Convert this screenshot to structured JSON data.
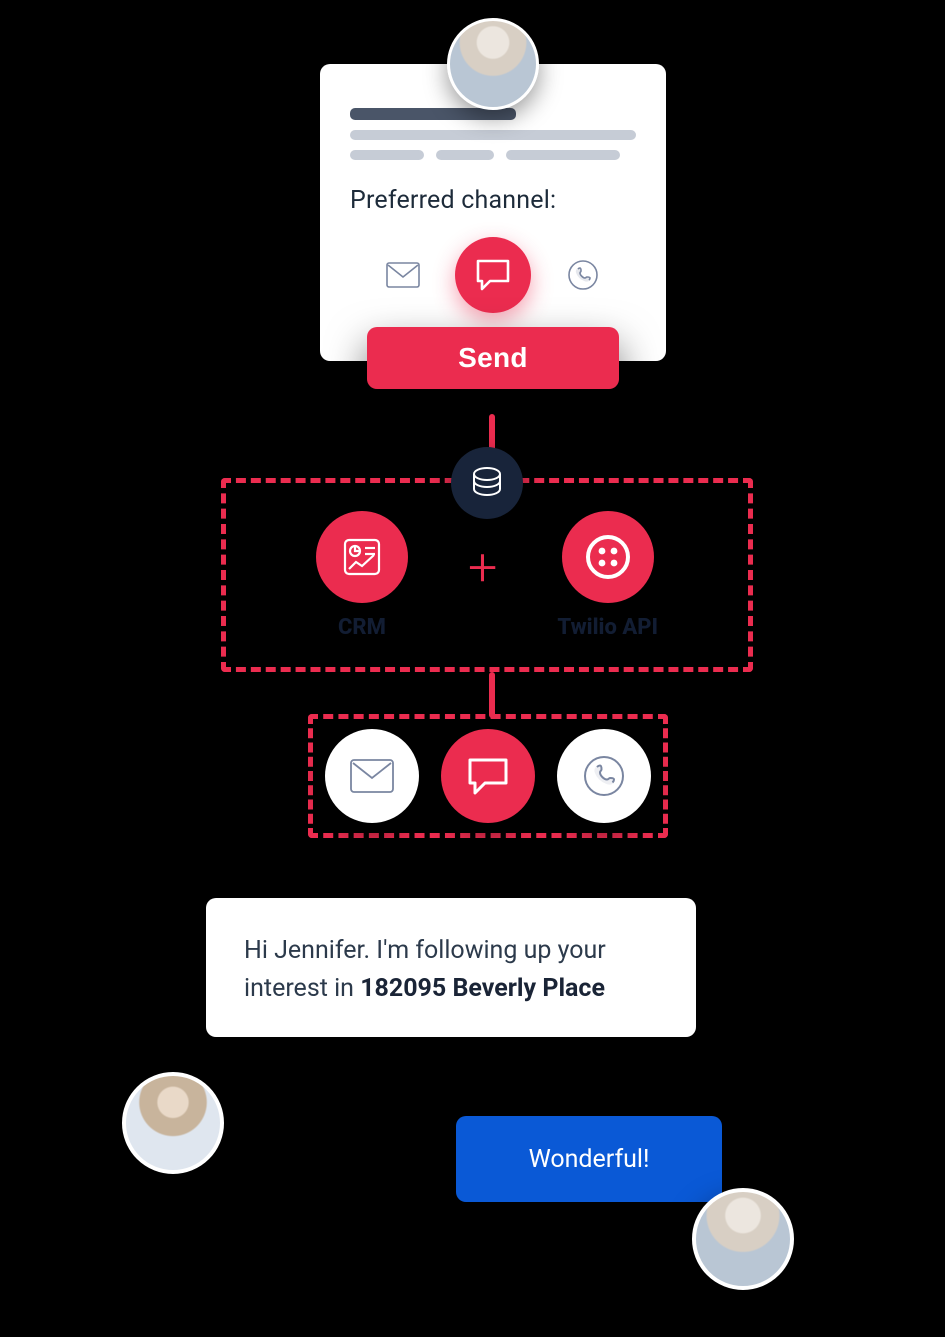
{
  "card": {
    "preferred_label": "Preferred channel:",
    "send_label": "Send",
    "channels": {
      "email": "email-icon",
      "chat": "chat-icon",
      "whatsapp": "whatsapp-icon"
    }
  },
  "processing": {
    "crm_label": "CRM",
    "api_label": "Twilio API"
  },
  "chat": {
    "agent_pre": "Hi Jennifer. I'm following up your interest in ",
    "agent_bold": "182095 Beverly Place",
    "user_reply": "Wonderful!"
  },
  "colors": {
    "red": "#eb2c4f",
    "blue": "#0a59d6",
    "navy": "#18243a"
  }
}
